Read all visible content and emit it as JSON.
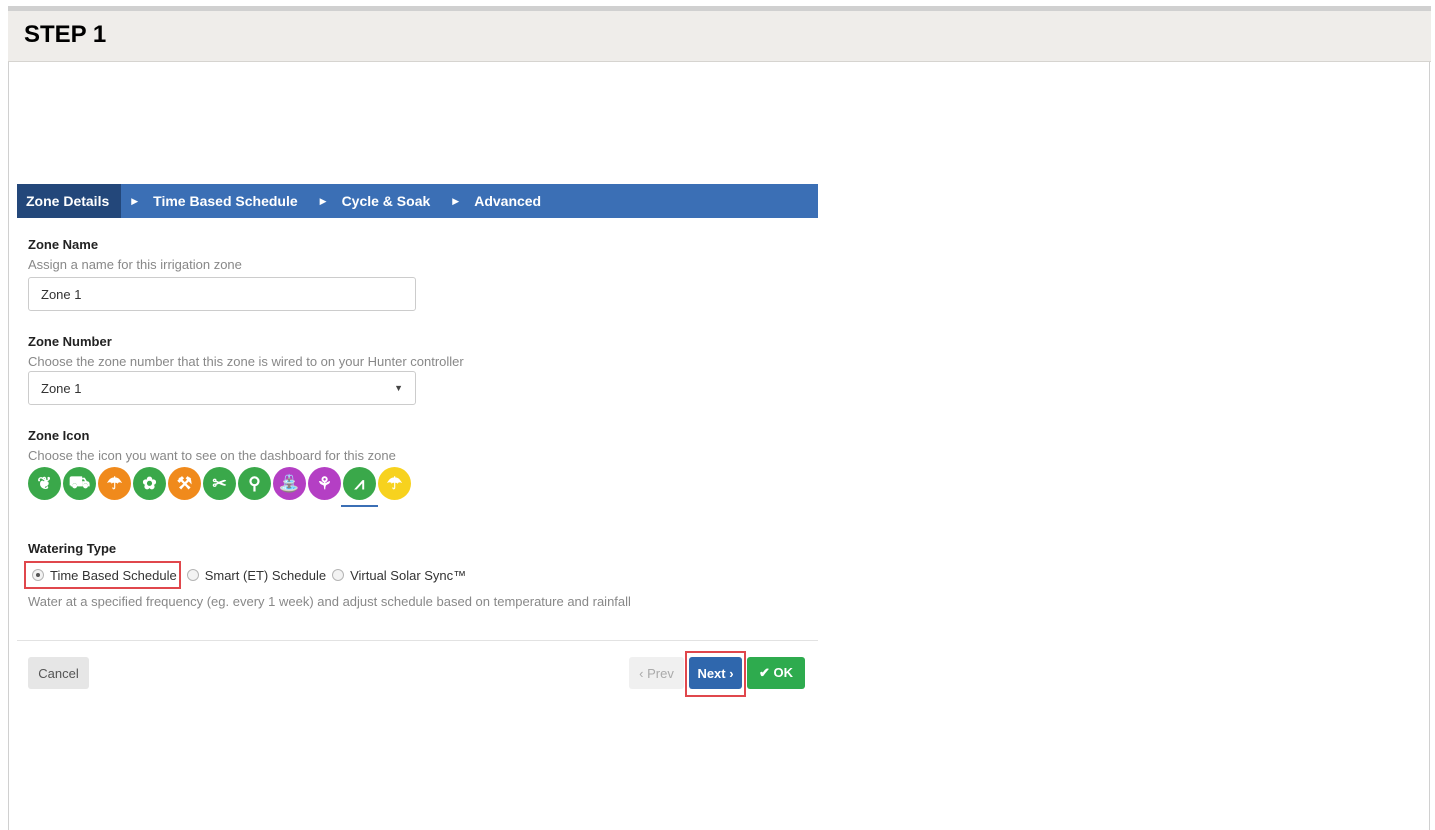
{
  "step": {
    "title": "STEP 1"
  },
  "tabs": [
    {
      "label": "Zone Details",
      "active": true
    },
    {
      "label": "Time Based Schedule",
      "active": false
    },
    {
      "label": "Cycle & Soak",
      "active": false
    },
    {
      "label": "Advanced",
      "active": false
    }
  ],
  "tab_separator": "▶",
  "zone_name": {
    "label": "Zone Name",
    "help": "Assign a name for this irrigation zone",
    "value": "Zone 1"
  },
  "zone_number": {
    "label": "Zone Number",
    "help": "Choose the zone number that this zone is wired to on your Hunter controller",
    "selected": "Zone 1",
    "caret": "▼"
  },
  "zone_icon": {
    "label": "Zone Icon",
    "help": "Choose the icon you want to see on the dashboard for this zone",
    "icons": [
      {
        "name": "leaf-icon",
        "glyph": "❦",
        "color": "#3aa84a"
      },
      {
        "name": "wheelbarrow-icon",
        "glyph": "⛟",
        "color": "#3aa84a"
      },
      {
        "name": "watering-can-icon",
        "glyph": "☂",
        "color": "#f08a1c"
      },
      {
        "name": "flower-icon",
        "glyph": "✿",
        "color": "#3aa84a"
      },
      {
        "name": "rake-icon",
        "glyph": "⚒",
        "color": "#f08a1c"
      },
      {
        "name": "shears-icon",
        "glyph": "✂",
        "color": "#3aa84a"
      },
      {
        "name": "shovel-icon",
        "glyph": "⚲",
        "color": "#3aa84a"
      },
      {
        "name": "sprinkler-icon",
        "glyph": "⛲",
        "color": "#b43fc4"
      },
      {
        "name": "sprout-icon",
        "glyph": "⚘",
        "color": "#b43fc4"
      },
      {
        "name": "grass-icon",
        "glyph": "⩘",
        "color": "#3aa84a",
        "selected": true
      },
      {
        "name": "umbrella-icon",
        "glyph": "☂",
        "color": "#f7d21e"
      }
    ]
  },
  "watering_type": {
    "label": "Watering Type",
    "options": [
      {
        "label": "Time Based Schedule",
        "checked": true
      },
      {
        "label": "Smart (ET) Schedule",
        "checked": false
      },
      {
        "label": "Virtual Solar Sync™",
        "checked": false
      }
    ],
    "description": "Water at a specified frequency (eg. every 1 week) and adjust schedule based on temperature and rainfall"
  },
  "footer": {
    "cancel": "Cancel",
    "prev": "‹ Prev",
    "next": "Next ›",
    "ok": "✔ OK"
  },
  "colors": {
    "tab_bar": "#3b6fb5",
    "tab_active": "#23477a",
    "highlight": "#e0474c",
    "ok_green": "#2eab4e",
    "next_blue": "#2f67ad"
  }
}
